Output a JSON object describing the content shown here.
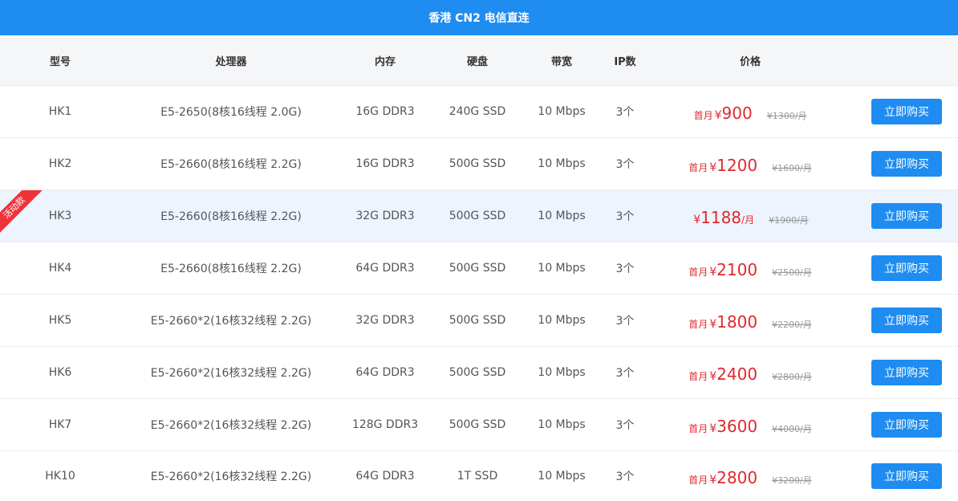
{
  "title": "香港 CN2 电信直连",
  "headers": {
    "model": "型号",
    "cpu": "处理器",
    "memory": "内存",
    "disk": "硬盘",
    "bandwidth": "带宽",
    "ip": "IP数",
    "price": "价格"
  },
  "badge_text": "活动款",
  "buy_label": "立即购买",
  "accent_color": "#1e8cf0",
  "price_color": "#e0282e",
  "rows": [
    {
      "model": "HK1",
      "cpu": "E5-2650(8核16线程 2.0G)",
      "memory": "16G DDR3",
      "disk": "240G SSD",
      "bandwidth": "10 Mbps",
      "ip": "3个",
      "prefix": "首月",
      "currency": "¥",
      "price": "900",
      "unit": "",
      "old_price": "¥1300/月"
    },
    {
      "model": "HK2",
      "cpu": "E5-2660(8核16线程 2.2G)",
      "memory": "16G DDR3",
      "disk": "500G SSD",
      "bandwidth": "10 Mbps",
      "ip": "3个",
      "prefix": "首月",
      "currency": "¥",
      "price": "1200",
      "unit": "",
      "old_price": "¥1600/月"
    },
    {
      "model": "HK3",
      "cpu": "E5-2660(8核16线程 2.2G)",
      "memory": "32G DDR3",
      "disk": "500G SSD",
      "bandwidth": "10 Mbps",
      "ip": "3个",
      "prefix": "",
      "currency": "¥",
      "price": "1188",
      "unit": "/月",
      "old_price": "¥1900/月"
    },
    {
      "model": "HK4",
      "cpu": "E5-2660(8核16线程 2.2G)",
      "memory": "64G DDR3",
      "disk": "500G SSD",
      "bandwidth": "10 Mbps",
      "ip": "3个",
      "prefix": "首月",
      "currency": "¥",
      "price": "2100",
      "unit": "",
      "old_price": "¥2500/月"
    },
    {
      "model": "HK5",
      "cpu": "E5-2660*2(16核32线程 2.2G)",
      "memory": "32G DDR3",
      "disk": "500G SSD",
      "bandwidth": "10 Mbps",
      "ip": "3个",
      "prefix": "首月",
      "currency": "¥",
      "price": "1800",
      "unit": "",
      "old_price": "¥2200/月"
    },
    {
      "model": "HK6",
      "cpu": "E5-2660*2(16核32线程 2.2G)",
      "memory": "64G DDR3",
      "disk": "500G SSD",
      "bandwidth": "10 Mbps",
      "ip": "3个",
      "prefix": "首月",
      "currency": "¥",
      "price": "2400",
      "unit": "",
      "old_price": "¥2800/月"
    },
    {
      "model": "HK7",
      "cpu": "E5-2660*2(16核32线程 2.2G)",
      "memory": "128G DDR3",
      "disk": "500G SSD",
      "bandwidth": "10 Mbps",
      "ip": "3个",
      "prefix": "首月",
      "currency": "¥",
      "price": "3600",
      "unit": "",
      "old_price": "¥4000/月"
    },
    {
      "model": "HK10",
      "cpu": "E5-2660*2(16核32线程 2.2G)",
      "memory": "64G DDR3",
      "disk": "1T SSD",
      "bandwidth": "10 Mbps",
      "ip": "3个",
      "prefix": "首月",
      "currency": "¥",
      "price": "2800",
      "unit": "",
      "old_price": "¥3200/月"
    }
  ]
}
